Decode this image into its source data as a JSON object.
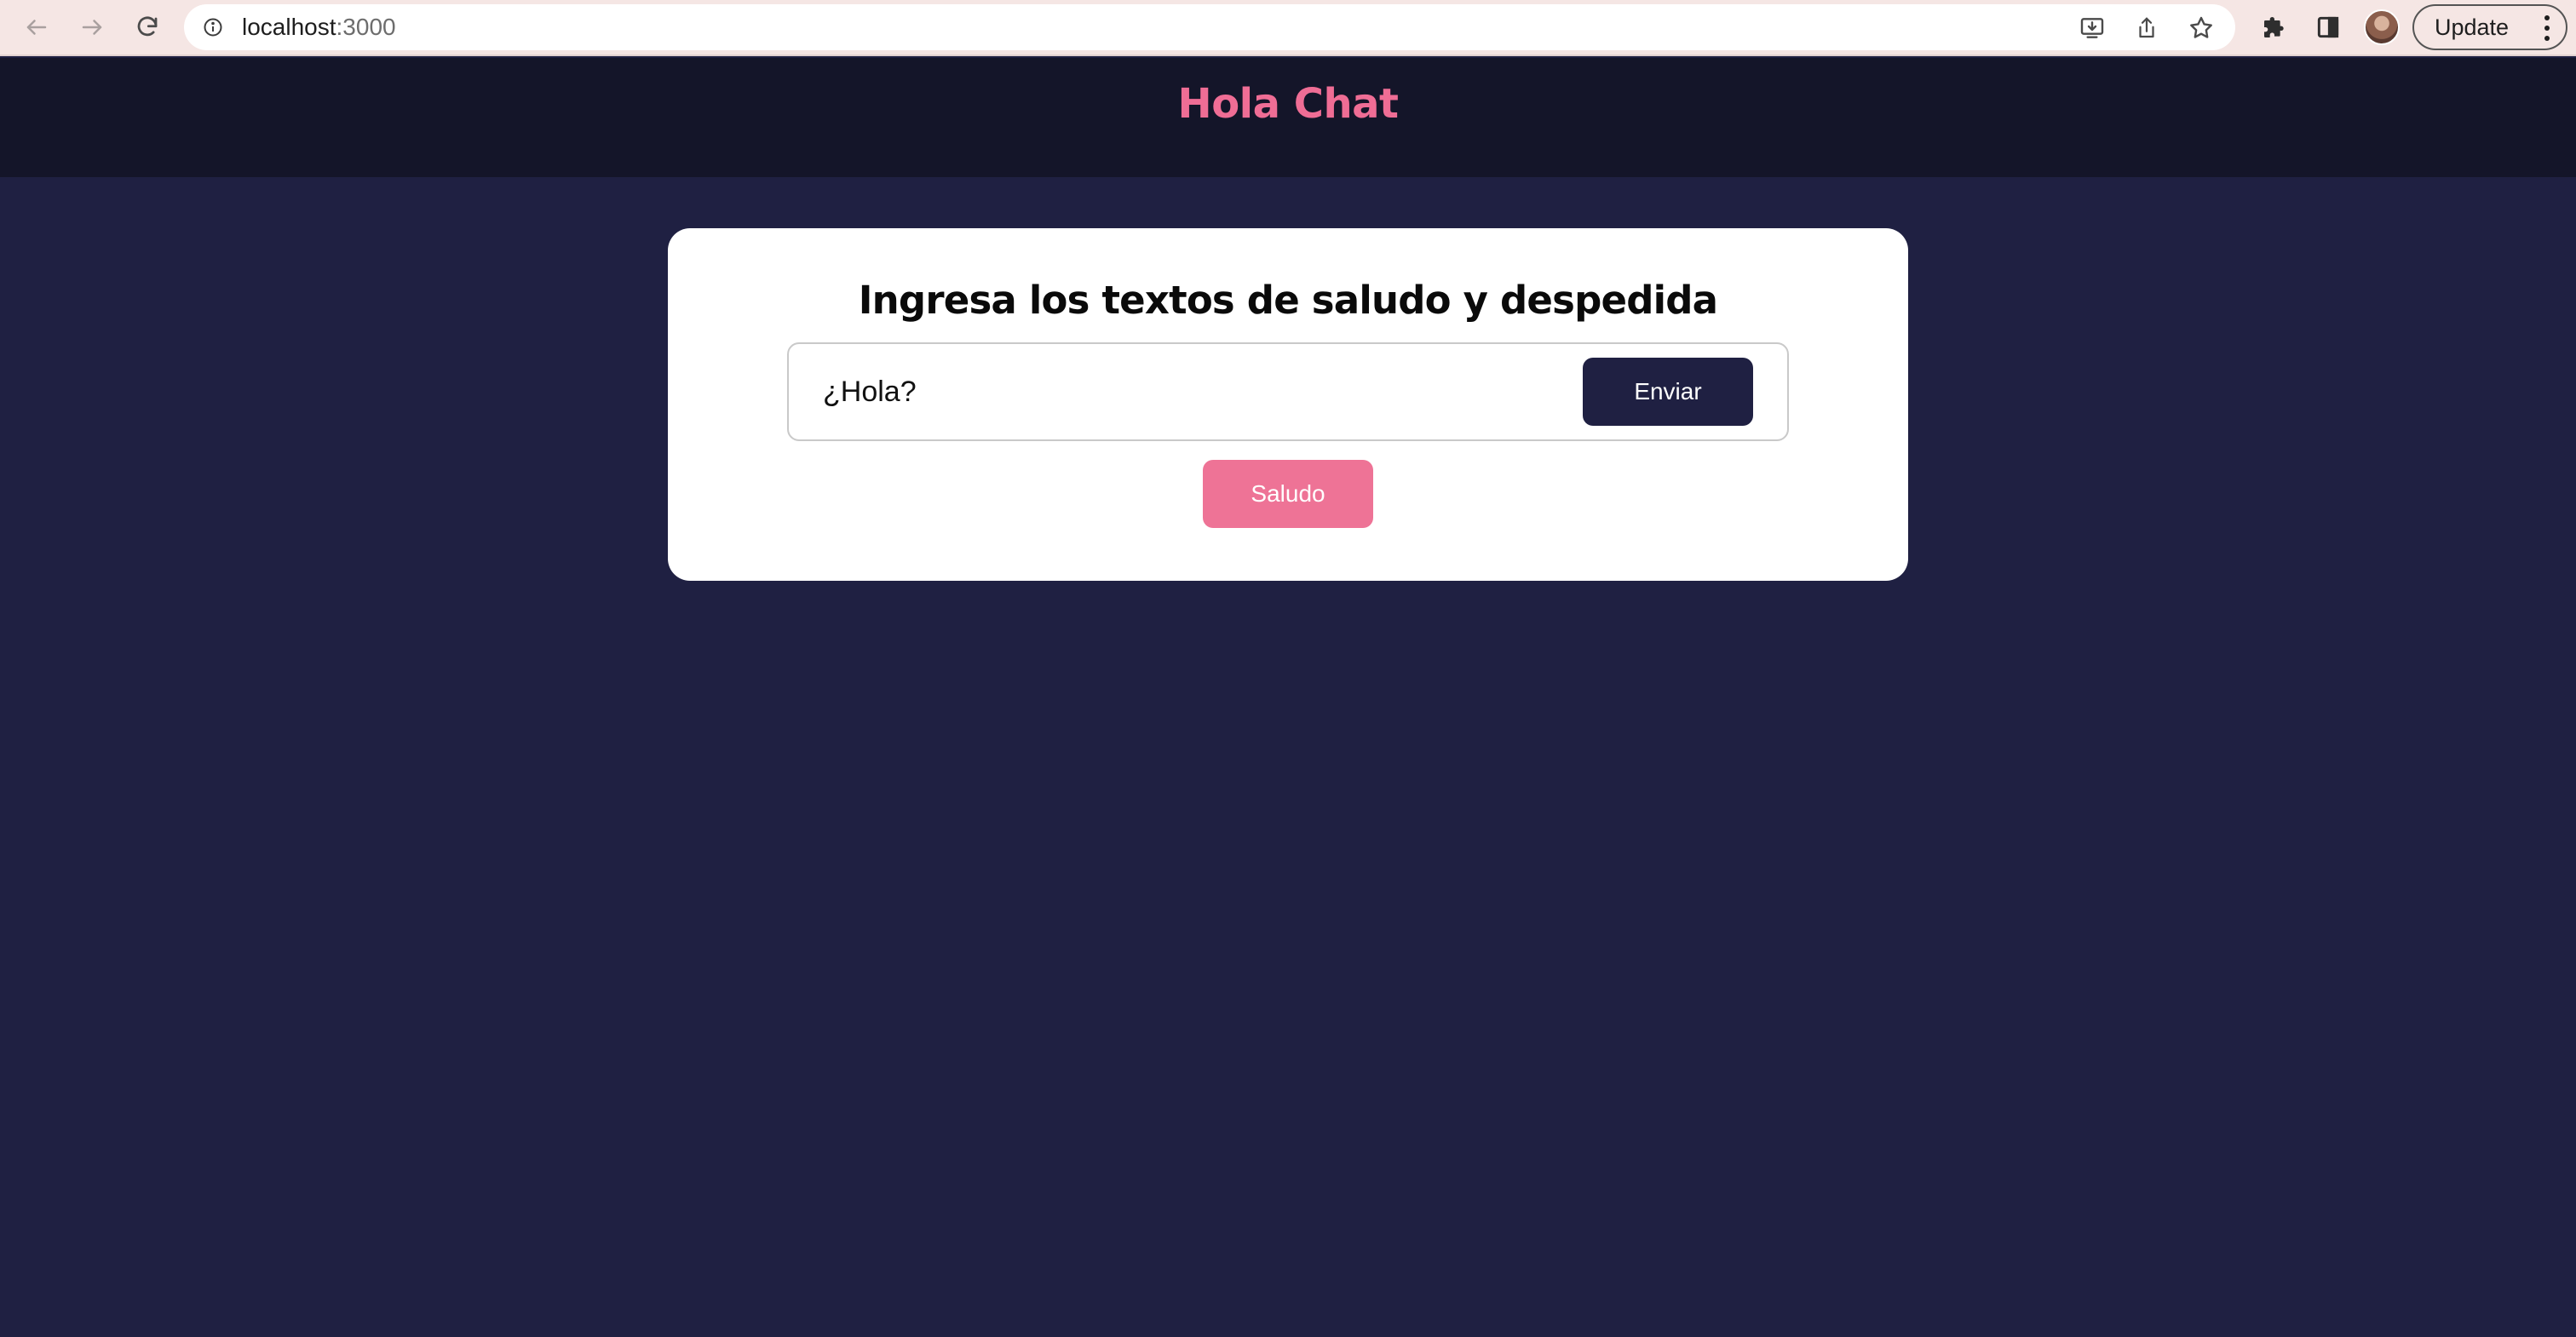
{
  "browser": {
    "url_host": "localhost",
    "url_port": ":3000",
    "update_label": "Update",
    "icons": {
      "back": "arrow-left-icon",
      "forward": "arrow-right-icon",
      "reload": "reload-icon",
      "site_info": "info-icon",
      "install": "install-app-icon",
      "share": "share-icon",
      "bookmark": "star-icon",
      "extensions": "puzzle-icon",
      "side_panel": "side-panel-icon",
      "menu": "kebab-menu-icon"
    }
  },
  "header": {
    "title": "Hola Chat"
  },
  "card": {
    "heading": "Ingresa los textos de saludo y despedida",
    "input_value": "¿Hola?",
    "send_label": "Enviar",
    "greeting_label": "Saludo"
  },
  "colors": {
    "header_bg": "#141529",
    "page_bg": "#1f2042",
    "accent_pink": "#ef6d95",
    "send_button": "#1f2042",
    "greeting_button": "#ee7396",
    "browser_bar": "#f5e6e4"
  }
}
